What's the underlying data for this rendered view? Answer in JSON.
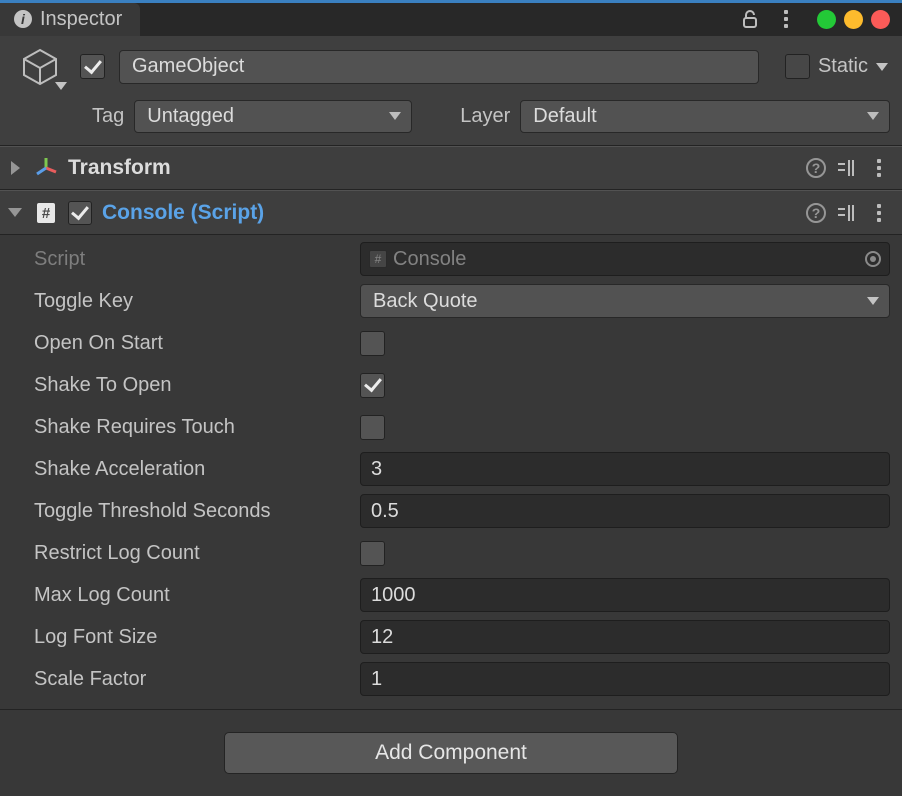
{
  "tab": {
    "title": "Inspector"
  },
  "header": {
    "enabled": true,
    "name": "GameObject",
    "static_label": "Static",
    "static_checked": false,
    "tag_label": "Tag",
    "tag_value": "Untagged",
    "layer_label": "Layer",
    "layer_value": "Default"
  },
  "transform": {
    "title": "Transform"
  },
  "console": {
    "title": "Console (Script)",
    "enabled": true,
    "script_label": "Script",
    "script_value": "Console",
    "toggle_key_label": "Toggle Key",
    "toggle_key_value": "Back Quote",
    "open_on_start_label": "Open On Start",
    "open_on_start": false,
    "shake_to_open_label": "Shake To Open",
    "shake_to_open": true,
    "shake_requires_touch_label": "Shake Requires Touch",
    "shake_requires_touch": false,
    "shake_acceleration_label": "Shake Acceleration",
    "shake_acceleration": "3",
    "toggle_threshold_label": "Toggle Threshold Seconds",
    "toggle_threshold": "0.5",
    "restrict_log_count_label": "Restrict Log Count",
    "restrict_log_count": false,
    "max_log_count_label": "Max Log Count",
    "max_log_count": "1000",
    "log_font_size_label": "Log Font Size",
    "log_font_size": "12",
    "scale_factor_label": "Scale Factor",
    "scale_factor": "1"
  },
  "add_component_label": "Add Component"
}
